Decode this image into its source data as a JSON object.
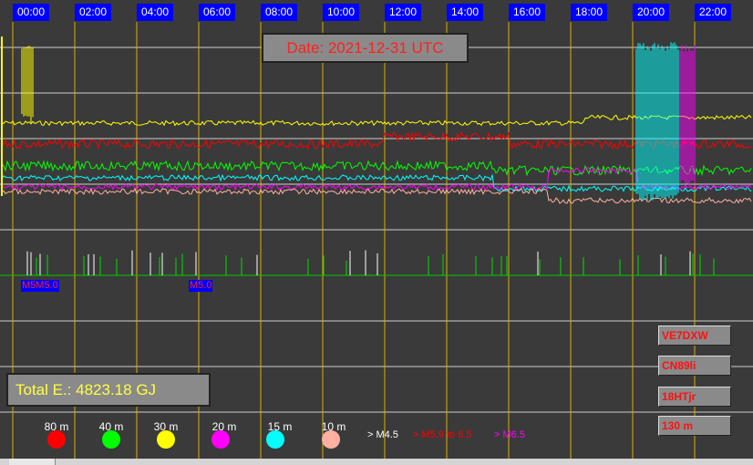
{
  "hours": [
    "00:00",
    "02:00",
    "04:00",
    "06:00",
    "08:00",
    "10:00",
    "12:00",
    "14:00",
    "16:00",
    "18:00",
    "20:00",
    "22:00"
  ],
  "date_label": "Date: 2021-12-31 UTC",
  "total_energy": "Total E.: 4823.18 GJ",
  "quake_tags": [
    "M5M5.0",
    "M5.0"
  ],
  "station": {
    "callsign": "VE7DXW",
    "grid": "CN89li",
    "code": "18HTjr",
    "band": "130 m"
  },
  "bands": [
    {
      "label": "80 m",
      "color": "#ff0000"
    },
    {
      "label": "40 m",
      "color": "#00ff00"
    },
    {
      "label": "30 m",
      "color": "#ffff00"
    },
    {
      "label": "20 m",
      "color": "#ff00ff"
    },
    {
      "label": "15 m",
      "color": "#00ffff"
    },
    {
      "label": "10 m",
      "color": "#ffb0a0"
    }
  ],
  "magnitude_legend": [
    {
      "label": "> M4.5",
      "color": "#ffffff"
    },
    {
      "label": "> M5.9 to 6.5",
      "color": "#ff0000"
    },
    {
      "label": "> M6.5",
      "color": "#ff00ff"
    }
  ]
}
